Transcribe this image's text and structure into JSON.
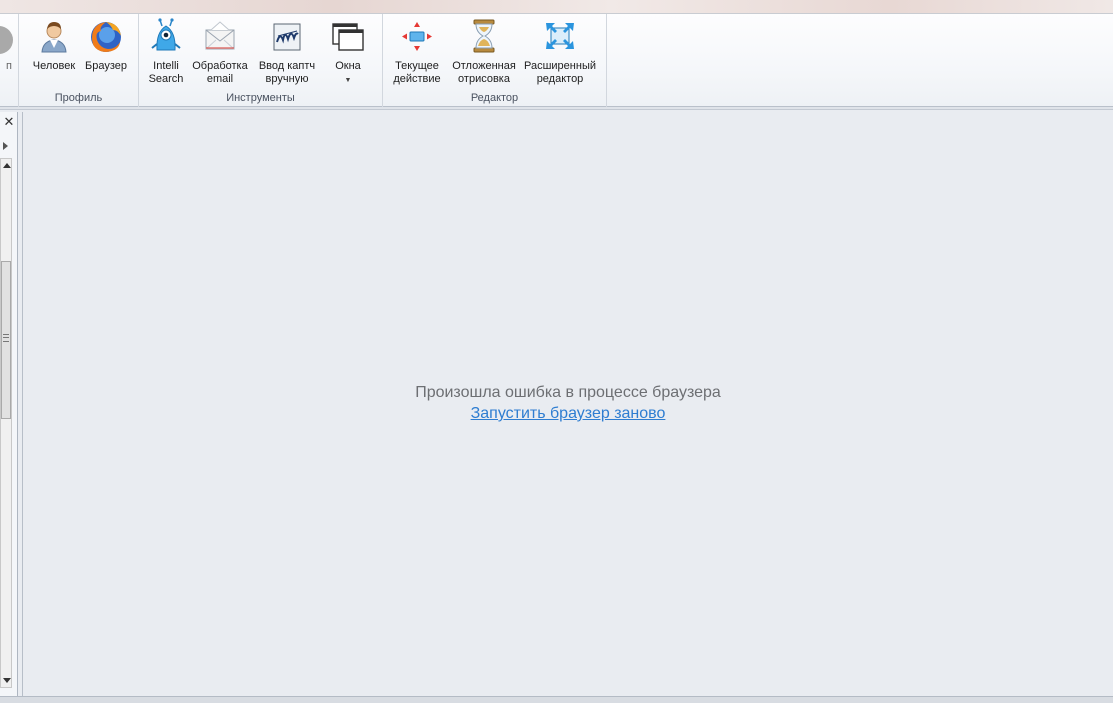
{
  "ribbon": {
    "cut_button_label": "п",
    "groups": {
      "profile": {
        "label": "Профиль",
        "human_label": "Человек",
        "browser_label": "Браузер"
      },
      "tools": {
        "label": "Инструменты",
        "intelli_label_1": "Intelli",
        "intelli_label_2": "Search",
        "email_label_1": "Обработка",
        "email_label_2": "email",
        "captcha_label_1": "Ввод каптч",
        "captcha_label_2": "вручную",
        "windows_label": "Окна"
      },
      "editor": {
        "label": "Редактор",
        "current_label_1": "Текущее",
        "current_label_2": "действие",
        "deferred_label_1": "Отложенная",
        "deferred_label_2": "отрисовка",
        "extended_label_1": "Расширенный",
        "extended_label_2": "редактор"
      }
    }
  },
  "main": {
    "error_message": "Произошла ошибка в процессе браузера",
    "restart_link": "Запустить браузер заново"
  },
  "colors": {
    "link": "#2e7dd1",
    "message": "#6d6f73",
    "background": "#e9ecf1"
  }
}
